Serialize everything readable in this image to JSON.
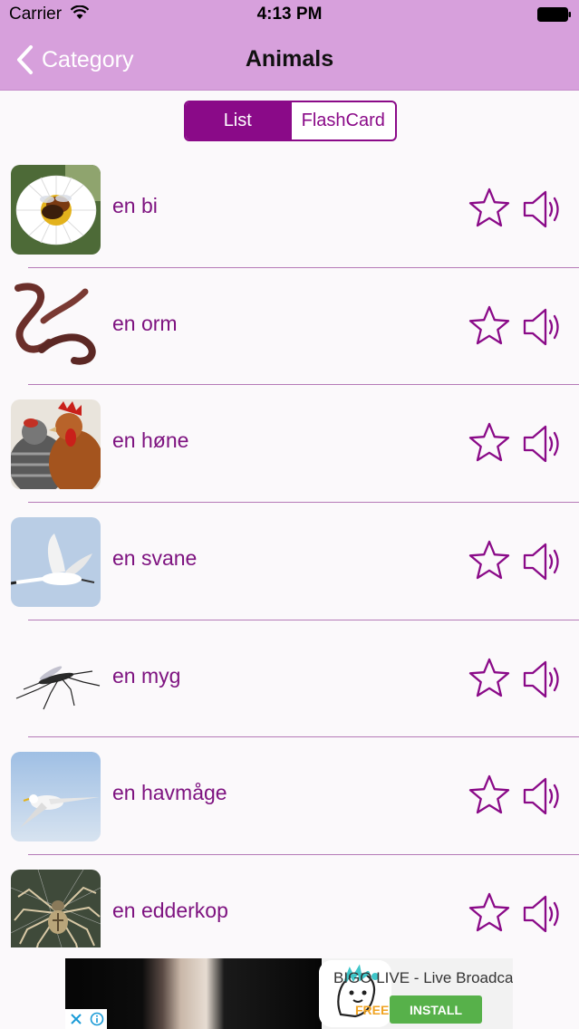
{
  "status_bar": {
    "carrier": "Carrier",
    "time": "4:13 PM"
  },
  "nav": {
    "back_label": "Category",
    "title": "Animals"
  },
  "segments": {
    "list": "List",
    "flashcard": "FlashCard"
  },
  "items": [
    {
      "word": "en bi",
      "image": "bee-on-flower"
    },
    {
      "word": "en orm",
      "image": "earthworms"
    },
    {
      "word": "en høne",
      "image": "chickens"
    },
    {
      "word": "en svane",
      "image": "flying-swan"
    },
    {
      "word": "en myg",
      "image": "mosquito"
    },
    {
      "word": "en havmåge",
      "image": "seagull"
    },
    {
      "word": "en edderkop",
      "image": "spider"
    }
  ],
  "ad": {
    "title": "BIGO LIVE - Live Broadca...",
    "free_label": "FREE",
    "install_label": "INSTALL"
  },
  "colors": {
    "nav_bg": "#d7a0dc",
    "accent": "#8a0a88",
    "word_text": "#7e1380"
  },
  "icons": {
    "back": "chevron-left-icon",
    "favorite": "star-outline-icon",
    "sound": "speaker-icon"
  }
}
